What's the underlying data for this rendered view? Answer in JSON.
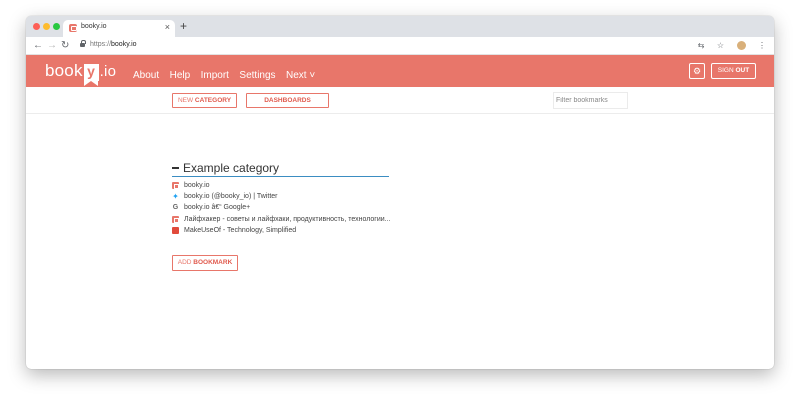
{
  "browser": {
    "tab_title": "booky.io",
    "tab_close": "×",
    "new_tab": "+",
    "url_scheme": "https://",
    "url_host": "booky.io"
  },
  "header": {
    "logo_left": "book",
    "logo_y": "y",
    "logo_right": ".io",
    "menu": [
      "About",
      "Help",
      "Import",
      "Settings",
      "Next ˅"
    ],
    "gear_icon": "⚙",
    "signout_light": "SIGN ",
    "signout_bold": "OUT"
  },
  "toolbar": {
    "new_light": "NEW ",
    "new_bold": "CATEGORY",
    "dashboards": "DASHBOARDS",
    "filter_placeholder": "Filter bookmarks"
  },
  "category": {
    "title": "Example category",
    "bookmarks": [
      {
        "label": "booky.io",
        "icon": "booky-icon"
      },
      {
        "label": "booky.io (@booky_io) | Twitter",
        "icon": "twitter-icon"
      },
      {
        "label": "booky.io â€“ Google+",
        "icon": "google-icon"
      },
      {
        "label": "Лайфхакер - советы и лайфхаки, продуктивность, технологии...",
        "icon": "lifehacker-icon"
      },
      {
        "label": "MakeUseOf - Technology, Simplified",
        "icon": "makeuseof-icon"
      }
    ],
    "add_light": "ADD ",
    "add_bold": "BOOKMARK"
  },
  "colors": {
    "brand": "#e8766a",
    "accent_line": "#3b8dc2"
  }
}
